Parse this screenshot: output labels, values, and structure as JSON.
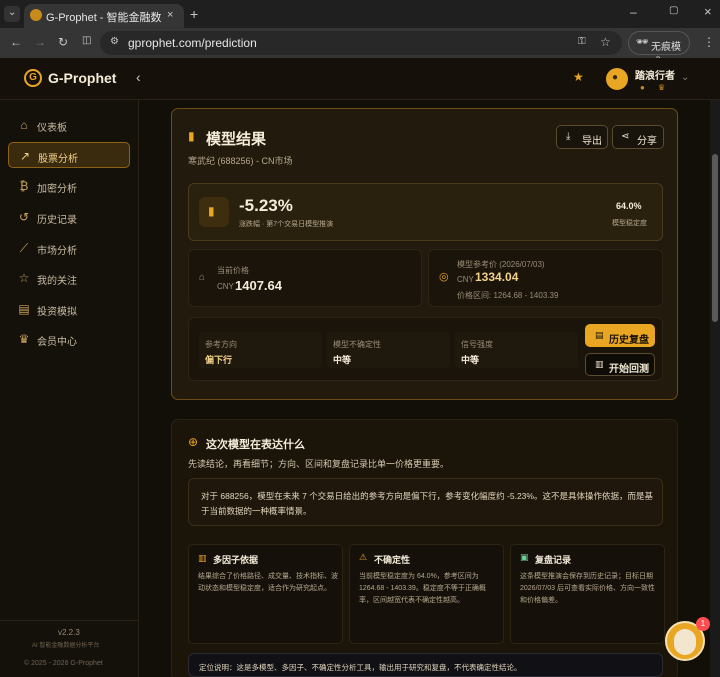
{
  "browser": {
    "tab_title": "G-Prophet - 智能金融数据分析",
    "url": "gprophet.com/prediction",
    "incognito_label": "无痕模式"
  },
  "appbar": {
    "brand": "G-Prophet",
    "user_name": "踏浪行者"
  },
  "sidebar": {
    "items": [
      {
        "label": "仪表板",
        "icon": "dashboard-icon"
      },
      {
        "label": "股票分析",
        "icon": "trend-icon"
      },
      {
        "label": "加密分析",
        "icon": "bitcoin-icon"
      },
      {
        "label": "历史记录",
        "icon": "history-icon"
      },
      {
        "label": "市场分析",
        "icon": "chart-icon"
      },
      {
        "label": "我的关注",
        "icon": "star-icon"
      },
      {
        "label": "投资模拟",
        "icon": "briefcase-icon"
      },
      {
        "label": "会员中心",
        "icon": "crown-icon"
      }
    ],
    "version": "v2.2.3",
    "tagline": "AI 智能金融数据分析平台",
    "copyright": "© 2025 - 2026 G-Prophet"
  },
  "result": {
    "title": "模型结果",
    "subtitle": "寒武纪 (688256) - CN市场",
    "export_label": "导出",
    "share_label": "分享",
    "change_pct": "-5.23%",
    "change_desc": "涨跌幅 · 第7个交易日模型推演",
    "stability_value": "64.0%",
    "stability_label": "模型稳定度",
    "current_price_label": "当前价格",
    "current_price_currency": "CNY",
    "current_price_value": "1407.64",
    "ref_price_label": "模型参考价 (2026/07/03)",
    "ref_price_currency": "CNY",
    "ref_price_value": "1334.04",
    "ref_price_range": "价格区间: 1264.68 - 1403.39",
    "direction_label": "参考方向",
    "direction_value": "偏下行",
    "uncertainty_label": "模型不确定性",
    "uncertainty_value": "中等",
    "signal_label": "信号强度",
    "signal_value": "中等",
    "history_button": "历史复盘",
    "backtest_button": "开始回测"
  },
  "explain": {
    "title": "这次模型在表达什么",
    "intro": "先读结论，再看细节；方向、区间和复盘记录比单一价格更重要。",
    "summary": "对于 688256，模型在未来 7 个交易日给出的参考方向是偏下行，参考变化幅度约 -5.23%。这不是具体操作依据，而是基于当前数据的一种概率情景。",
    "cards": [
      {
        "title": "多因子依据",
        "body": "结果综合了价格路径、成交量、技术指标、波动状态和模型稳定度，适合作为研究起点。"
      },
      {
        "title": "不确定性",
        "body": "当前模型稳定度为 64.0%，参考区间为 1264.68 - 1403.39。稳定度不等于正确概率，区间越宽代表不确定性越高。"
      },
      {
        "title": "复盘记录",
        "body": "这条模型推演会保存到历史记录；目标日期 2026/07/03 后可查看实际价格、方向一致性和价格偏差。"
      }
    ],
    "note": "定位说明：这是多模型、多因子、不确定性分析工具，输出用于研究和复盘，不代表确定性结论。"
  },
  "chat_badge_count": "1",
  "colors": {
    "accent": "#e8a623",
    "danger": "#ff4d4f",
    "background": "#120e08"
  }
}
